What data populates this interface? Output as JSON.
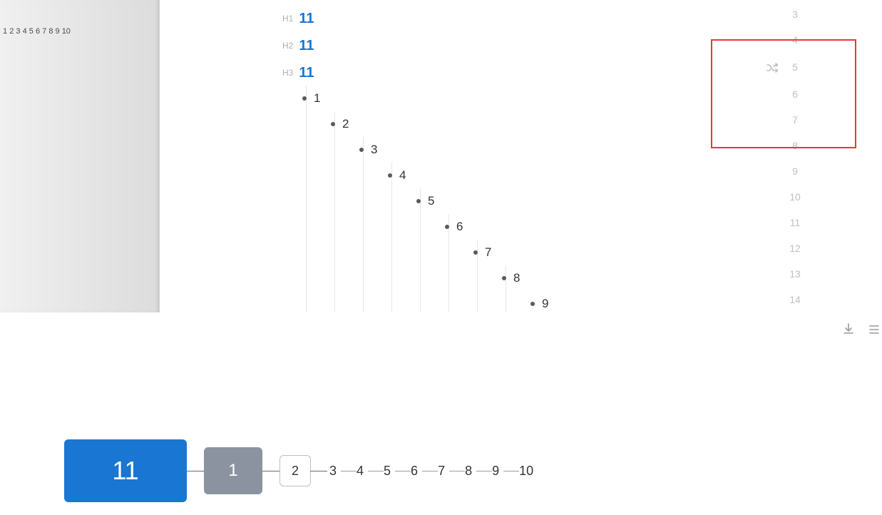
{
  "minimap": {
    "numbers": [
      "1",
      "2",
      "3",
      "4",
      "5",
      "6",
      "7",
      "8",
      "9",
      "10"
    ]
  },
  "editor": {
    "headings": [
      {
        "tag": "H1",
        "value": "11"
      },
      {
        "tag": "H2",
        "value": "11"
      },
      {
        "tag": "H3",
        "value": "11"
      }
    ],
    "list": [
      "1",
      "2",
      "3",
      "4",
      "5",
      "6",
      "7",
      "8",
      "9"
    ],
    "gutter_lines": [
      "3",
      "4",
      "5",
      "6",
      "7",
      "8",
      "9",
      "10",
      "11",
      "12",
      "13",
      "14"
    ]
  },
  "trail": {
    "root": "11",
    "nodes": [
      "1",
      "2",
      "3",
      "4",
      "5",
      "6",
      "7",
      "8",
      "9",
      "10"
    ]
  }
}
